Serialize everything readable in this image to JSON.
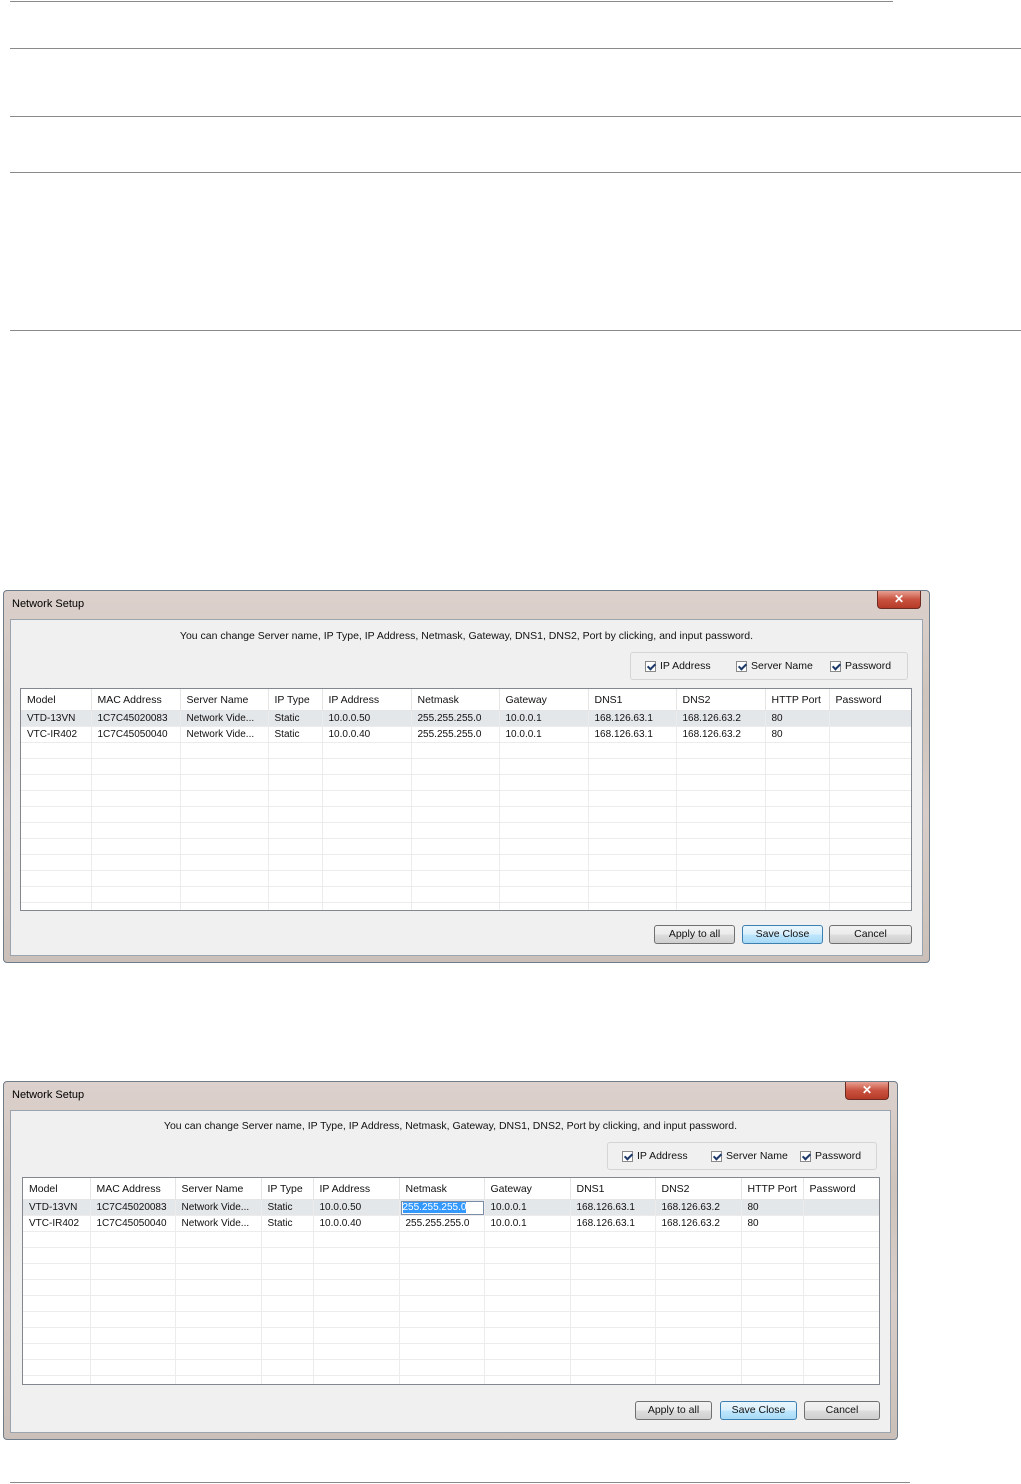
{
  "dialog": {
    "title": "Network Setup",
    "close_glyph": "✕",
    "instruction": "You can change Server name, IP Type, IP Address, Netmask, Gateway, DNS1, DNS2, Port by clicking, and input password.",
    "options": [
      {
        "label": "IP Address",
        "checked": true
      },
      {
        "label": "Server Name",
        "checked": true
      },
      {
        "label": "Password",
        "checked": true
      }
    ],
    "columns": [
      "Model",
      "MAC Address",
      "Server Name",
      "IP Type",
      "IP Address",
      "Netmask",
      "Gateway",
      "DNS1",
      "DNS2",
      "HTTP Port",
      "Password"
    ],
    "rows": [
      [
        "VTD-13VN",
        "1C7C45020083",
        "Network Vide...",
        "Static",
        "10.0.0.50",
        "255.255.255.0",
        "10.0.0.1",
        "168.126.63.1",
        "168.126.63.2",
        "80",
        ""
      ],
      [
        "VTC-IR402",
        "1C7C45050040",
        "Network Vide...",
        "Static",
        "10.0.0.40",
        "255.255.255.0",
        "10.0.0.1",
        "168.126.63.1",
        "168.126.63.2",
        "80",
        ""
      ]
    ],
    "buttons": {
      "apply_all": "Apply to all",
      "save_close": "Save  Close",
      "cancel": "Cancel"
    }
  },
  "colors": {
    "selection": "#e4e7ea",
    "edit_highlight": "#3399ff",
    "close_button": "#c9523f"
  }
}
